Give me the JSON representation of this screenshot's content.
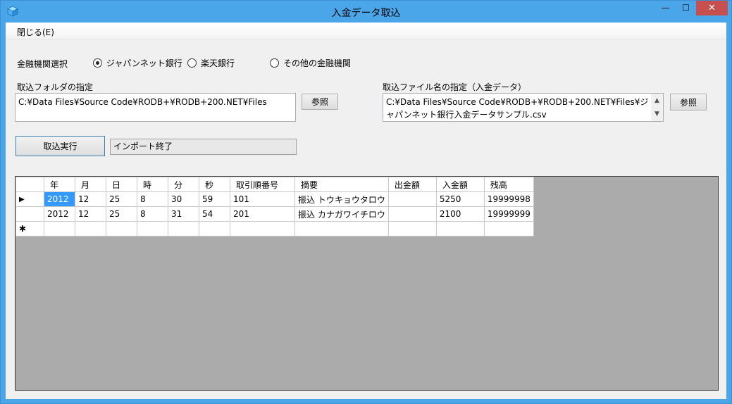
{
  "window": {
    "title": "入金データ取込",
    "minimize_glyph": "—",
    "maximize_glyph": "☐",
    "close_glyph": "✕"
  },
  "menu": {
    "close": "閉じる(E)"
  },
  "bank_select": {
    "label": "金融機関選択",
    "options": [
      "ジャパンネット銀行",
      "楽天銀行",
      "その他の金融機関"
    ],
    "selected": "ジャパンネット銀行"
  },
  "folder": {
    "label": "取込フォルダの指定",
    "value": "C:¥Data Files¥Source Code¥RODB+¥RODB+200.NET¥Files",
    "browse_label": "参照"
  },
  "file": {
    "label": "取込ファイル名の指定（入金データ）",
    "value": "C:¥Data Files¥Source Code¥RODB+¥RODB+200.NET¥Files¥ジャパンネット銀行入金データサンプル.csv",
    "browse_label": "参照"
  },
  "import": {
    "button_label": "取込実行",
    "status": "インポート終了"
  },
  "grid": {
    "columns": [
      "年",
      "月",
      "日",
      "時",
      "分",
      "秒",
      "取引順番号",
      "摘要",
      "出金額",
      "入金額",
      "残高"
    ],
    "rows": [
      [
        "2012",
        "12",
        "25",
        "8",
        "30",
        "59",
        "101",
        "振込 トウキョウタロウ",
        "",
        "5250",
        "19999998"
      ],
      [
        "2012",
        "12",
        "25",
        "8",
        "31",
        "54",
        "201",
        "振込 カナガワイチロウ",
        "",
        "2100",
        "19999999"
      ]
    ],
    "current_row_marker": "▶",
    "new_row_marker": "✱"
  },
  "colors": {
    "accent": "#3399ff",
    "title_bar": "#4aa6e8",
    "close_button": "#c74f4f",
    "grid_background": "#ababab"
  }
}
